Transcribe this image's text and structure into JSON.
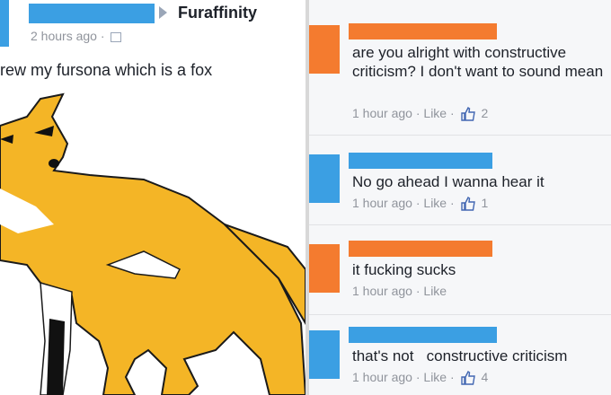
{
  "post": {
    "group": "Furaffinity",
    "time": "2 hours ago",
    "separator": "·",
    "text": "rew my fursona which is a fox",
    "colors": {
      "redact_blue": "#3b9fe3",
      "fox_fill": "#f4b526"
    }
  },
  "comments": [
    {
      "avatar_color": "#f47b2f",
      "name_color": "#f47b2f",
      "text": "are you alright with constructive criticism? I don't want to sound mean",
      "time": "1 hour ago",
      "like_label": "Like",
      "likes": "2"
    },
    {
      "avatar_color": "#3b9fe3",
      "name_color": "#3b9fe3",
      "text": "No go ahead I wanna hear it",
      "time": "1 hour ago",
      "like_label": "Like",
      "likes": "1"
    },
    {
      "avatar_color": "#f47b2f",
      "name_color": "#f47b2f",
      "text": "it fucking sucks",
      "time": "1 hour ago",
      "like_label": "Like",
      "likes": ""
    },
    {
      "avatar_color": "#3b9fe3",
      "name_color": "#3b9fe3",
      "text": "that's not   constructive criticism",
      "time": "1 hour ago",
      "like_label": "Like",
      "likes": "4"
    }
  ],
  "meta_separator": "·"
}
